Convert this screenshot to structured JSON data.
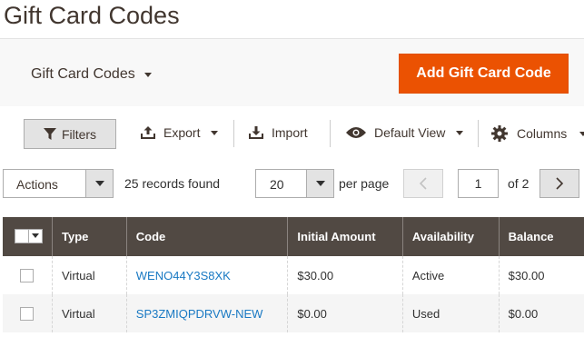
{
  "page": {
    "title": "Gift Card Codes"
  },
  "actions_bar": {
    "store_switcher_label": "Gift Card Codes",
    "add_button_label": "Add Gift Card Code"
  },
  "toolbar": {
    "filters_label": "Filters",
    "export_label": "Export",
    "import_label": "Import",
    "view_label": "Default View",
    "columns_label": "Columns"
  },
  "grid_controls": {
    "actions_label": "Actions",
    "records_found": "25 records found",
    "per_page_value": "20",
    "per_page_label": "per page",
    "current_page": "1",
    "total_pages_label": "of 2"
  },
  "table": {
    "columns": [
      "Type",
      "Code",
      "Initial Amount",
      "Availability",
      "Balance"
    ],
    "rows": [
      {
        "type": "Virtual",
        "code": "WENO44Y3S8XK",
        "initial_amount": "$30.00",
        "availability": "Active",
        "balance": "$30.00"
      },
      {
        "type": "Virtual",
        "code": "SP3ZMIQPDRVW-NEW",
        "initial_amount": "$0.00",
        "availability": "Used",
        "balance": "$0.00"
      }
    ]
  },
  "colors": {
    "accent": "#eb5202",
    "header_bg": "#514943",
    "link": "#1979c3"
  }
}
